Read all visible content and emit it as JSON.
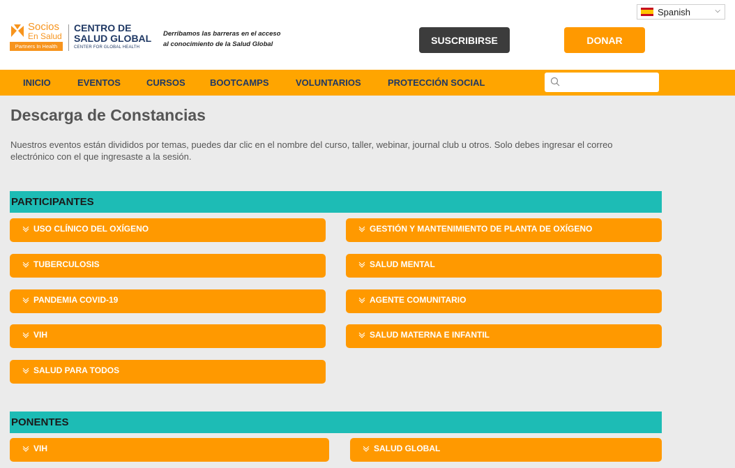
{
  "language": {
    "selected": "Spanish"
  },
  "brand": {
    "socios": "Socios",
    "en_salud": "En Salud",
    "partners": "Partners In Health",
    "centro_line1": "CENTRO DE",
    "centro_line2": "SALUD GLOBAL",
    "center_en": "CENTER FOR GLOBAL HEALTH",
    "tagline_1": "Derribamos las barreras en el acceso",
    "tagline_2": "al conocimiento de la Salud Global"
  },
  "header_buttons": {
    "subscribe": "SUSCRIBIRSE",
    "donate": "DONAR"
  },
  "nav": [
    {
      "label": "INICIO"
    },
    {
      "label": "EVENTOS"
    },
    {
      "label": "CURSOS"
    },
    {
      "label": "BOOTCAMPS"
    },
    {
      "label": "VOLUNTARIOS"
    },
    {
      "label": "PROTECCIÓN SOCIAL"
    }
  ],
  "search": {
    "placeholder": ""
  },
  "page": {
    "title": "Descarga de Constancias",
    "intro": "Nuestros eventos están divididos por temas, puedes dar clic en el nombre del curso, taller, webinar, journal club u otros. Solo debes ingresar el correo electrónico con el que ingresaste a la sesión."
  },
  "sections": [
    {
      "title": "PARTICIPANTES",
      "items": [
        {
          "label": "USO CLÍNICO DEL OXÍGENO"
        },
        {
          "label": "GESTIÓN Y MANTENIMIENTO DE PLANTA DE OXÍGENO"
        },
        {
          "label": "TUBERCULOSIS"
        },
        {
          "label": "SALUD MENTAL"
        },
        {
          "label": "PANDEMIA COVID-19"
        },
        {
          "label": "AGENTE COMUNITARIO"
        },
        {
          "label": "VIH"
        },
        {
          "label": "SALUD MATERNA E INFANTIL"
        },
        {
          "label": "SALUD PARA TODOS"
        }
      ]
    },
    {
      "title": "PONENTES",
      "items": [
        {
          "label": "VIH"
        },
        {
          "label": "SALUD GLOBAL"
        }
      ]
    }
  ],
  "colors": {
    "orange": "#ff9900",
    "teal": "#1dbcb5",
    "navy": "#1f3864",
    "dark_button": "#3c3c3c"
  }
}
